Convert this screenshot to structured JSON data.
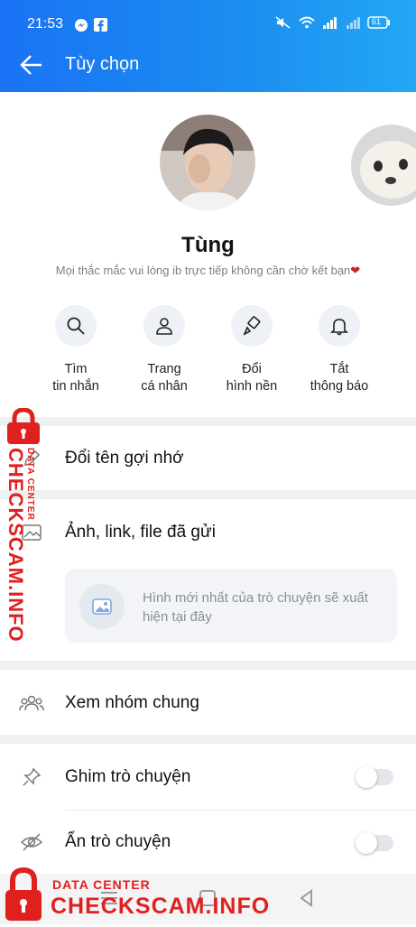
{
  "status_bar": {
    "time": "21:53",
    "battery": "61"
  },
  "header": {
    "title": "Tùy chọn"
  },
  "profile": {
    "name": "Tùng",
    "status": "Mọi thắc mắc vui lòng ib trực tiếp không cần chờ kết bạn",
    "status_emoji": "❤"
  },
  "quick_actions": [
    {
      "label": "Tìm\ntin nhắn",
      "icon": "search-icon"
    },
    {
      "label": "Trang\ncá nhân",
      "icon": "person-icon"
    },
    {
      "label": "Đổi\nhình nền",
      "icon": "paintbrush-icon"
    },
    {
      "label": "Tắt\nthông báo",
      "icon": "bell-icon"
    }
  ],
  "menu": {
    "rename": "Đổi tên gợi nhớ",
    "media": "Ảnh, link, file đã gửi",
    "media_placeholder": "Hình mới nhất của trò chuyện sẽ xuất hiện tại đây",
    "groups": "Xem nhóm chung",
    "pin": "Ghim trò chuyện",
    "hide": "Ẩn trò chuyện"
  },
  "toggles": {
    "pin": false,
    "hide": false
  },
  "watermark": {
    "top": "DATA CENTER",
    "main": "CHECKSCAM.INFO"
  },
  "colors": {
    "header_start": "#1a73f5",
    "header_end": "#23a8f4",
    "watermark": "#e0201f"
  }
}
